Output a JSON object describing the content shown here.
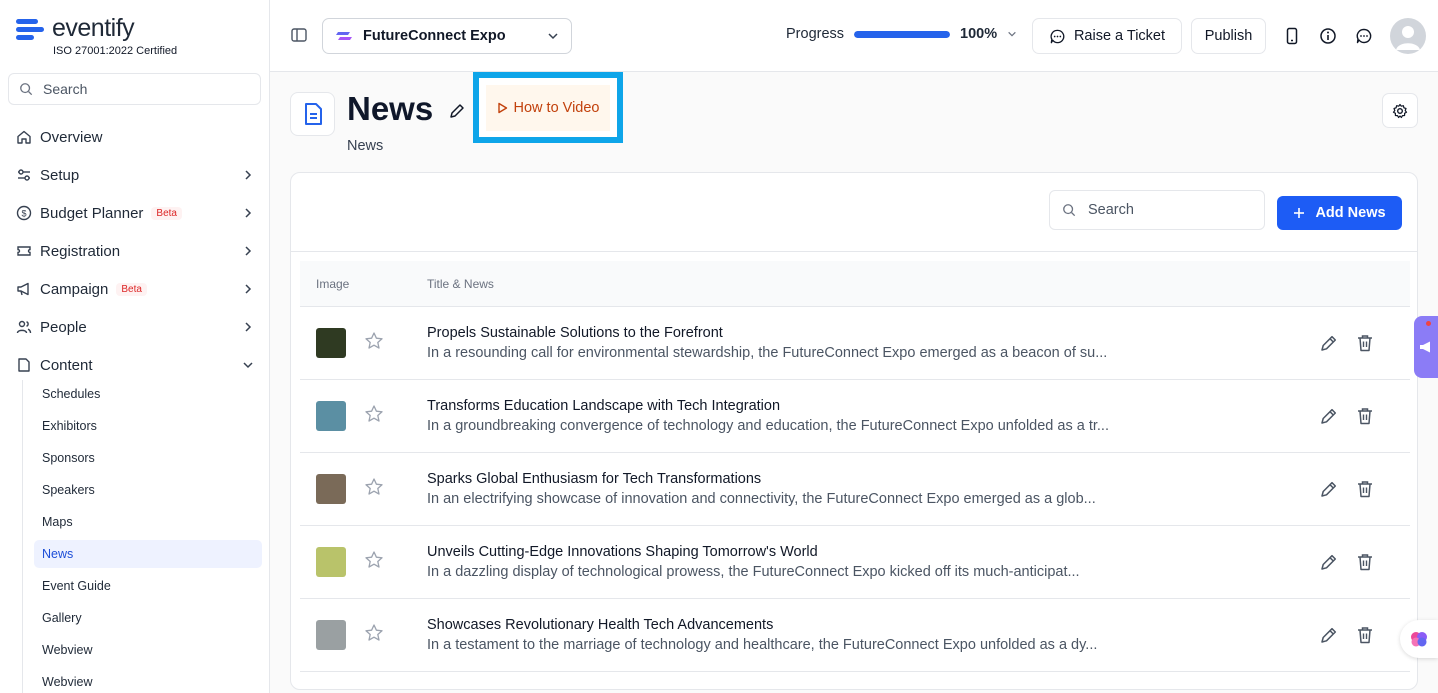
{
  "brand": {
    "name": "eventify",
    "certification": "ISO 27001:2022 Certified"
  },
  "sidebar": {
    "search_placeholder": "Search",
    "items": [
      {
        "label": "Overview",
        "icon": "home-icon",
        "chevron": ""
      },
      {
        "label": "Setup",
        "icon": "sliders-icon",
        "chevron": "right"
      },
      {
        "label": "Budget Planner",
        "icon": "dollar-icon",
        "chevron": "right",
        "badge": "Beta"
      },
      {
        "label": "Registration",
        "icon": "ticket-icon",
        "chevron": "right"
      },
      {
        "label": "Campaign",
        "icon": "megaphone-icon",
        "chevron": "right",
        "badge": "Beta"
      },
      {
        "label": "People",
        "icon": "people-icon",
        "chevron": "right"
      },
      {
        "label": "Content",
        "icon": "document-icon",
        "chevron": "down"
      }
    ],
    "content_subitems": [
      "Schedules",
      "Exhibitors",
      "Sponsors",
      "Speakers",
      "Maps",
      "News",
      "Event Guide",
      "Gallery",
      "Webview",
      "Webview"
    ],
    "active_subitem": "News"
  },
  "topbar": {
    "event_name": "FutureConnect Expo",
    "progress_label": "Progress",
    "progress_percent": "100%",
    "progress_value": 1.0,
    "raise_ticket_label": "Raise a Ticket",
    "publish_label": "Publish"
  },
  "page": {
    "title": "News",
    "subtitle": "News",
    "how_to_label": "How to Video"
  },
  "table": {
    "search_placeholder": "Search",
    "add_label": "Add News",
    "col_image": "Image",
    "col_title": "Title & News",
    "rows": [
      {
        "title": "Propels Sustainable Solutions to the Forefront",
        "body": "In a resounding call for environmental stewardship, the FutureConnect Expo emerged as a beacon of su...",
        "thumb_color": "#2f3a22"
      },
      {
        "title": "Transforms Education Landscape with Tech Integration",
        "body": "In a groundbreaking convergence of technology and education, the FutureConnect Expo unfolded as a tr...",
        "thumb_color": "#5b8fa3"
      },
      {
        "title": "Sparks Global Enthusiasm for Tech Transformations",
        "body": "In an electrifying showcase of innovation and connectivity, the FutureConnect Expo emerged as a glob...",
        "thumb_color": "#7a6a58"
      },
      {
        "title": "Unveils Cutting-Edge Innovations Shaping Tomorrow's World",
        "body": "In a dazzling display of technological prowess, the FutureConnect Expo kicked off its much-anticipat...",
        "thumb_color": "#b9c36a"
      },
      {
        "title": "Showcases Revolutionary Health Tech Advancements",
        "body": "In a testament to the marriage of technology and healthcare, the FutureConnect Expo unfolded as a dy...",
        "thumb_color": "#9aa0a2"
      }
    ]
  },
  "colors": {
    "accent": "#1d5cf5",
    "highlight_border": "#0ea5e9",
    "beta": "#dc2626",
    "howto_text": "#c2410c"
  }
}
